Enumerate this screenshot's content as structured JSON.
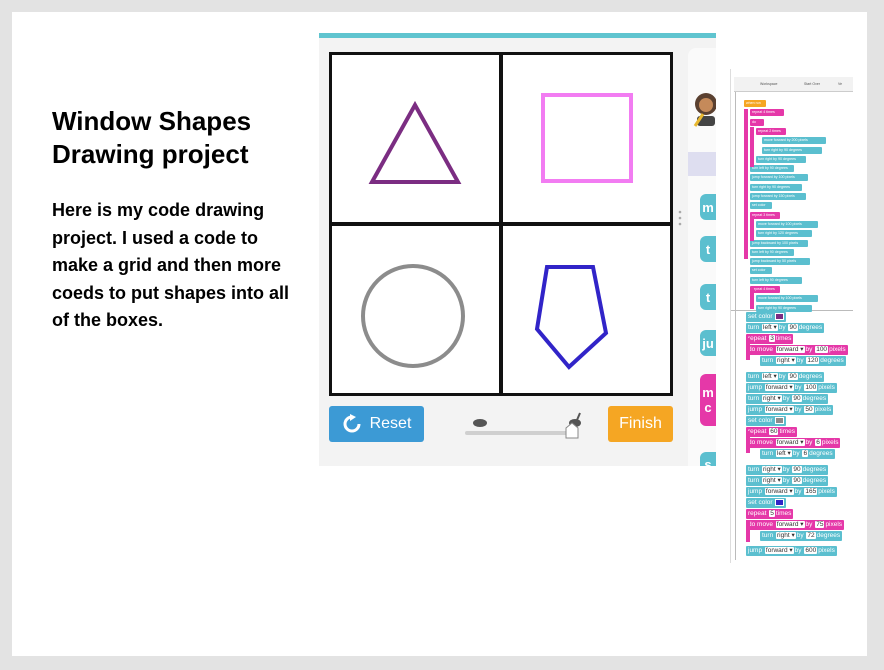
{
  "slide": {
    "title": "Window Shapes\nDrawing project",
    "body": "Here is my code drawing project. I used a code to make a grid and then more coeds to put shapes into all of the boxes."
  },
  "app": {
    "reset_label": "Reset",
    "finish_label": "Finish",
    "side_tabs": [
      "m",
      "t",
      "t",
      "ju",
      "m",
      "c",
      "s"
    ],
    "shape_colors": {
      "triangle": "#7b2d82",
      "square": "#f27cf2",
      "circle": "#8c8c8c",
      "pentagon": "#3124c8"
    },
    "accent_colors": {
      "reset": "#3c9ad5",
      "finish": "#f5a623",
      "topbar": "#5fc4cf",
      "block": "#5bbfcf",
      "loop": "#e538a8"
    }
  },
  "code_panel": {
    "toolbar": {
      "a": "Workspace",
      "b": "Start Over",
      "c": "Ve"
    },
    "upper_blocks": [
      {
        "text": "when run",
        "style": "orange"
      },
      {
        "text": "repeat 4 times",
        "style": "pink"
      },
      {
        "text": "do",
        "style": "pink"
      },
      {
        "text": "repeat 2 times",
        "style": "pink"
      },
      {
        "text": "move forward by 200 pixels",
        "style": "teal"
      },
      {
        "text": "turn right by 90 degrees",
        "style": "teal"
      },
      {
        "text": "turn right by 90 degrees",
        "style": "teal"
      },
      {
        "text": "turn left by 90 degrees",
        "style": "teal"
      },
      {
        "text": "jump forward by 100 pixels",
        "style": "teal"
      },
      {
        "text": "turn right by 90 degrees",
        "style": "teal"
      },
      {
        "text": "jump forward by 150 pixels",
        "style": "teal"
      },
      {
        "text": "set color",
        "style": "teal"
      },
      {
        "text": "repeat 3 times",
        "style": "pink"
      },
      {
        "text": "move forward by 100 pixels",
        "style": "teal"
      },
      {
        "text": "turn right by 120 degrees",
        "style": "teal"
      },
      {
        "text": "jump backward by 100 pixels",
        "style": "teal"
      },
      {
        "text": "turn left by 90 degrees",
        "style": "teal"
      },
      {
        "text": "jump backward by 50 pixels",
        "style": "teal"
      },
      {
        "text": "set color",
        "style": "teal"
      },
      {
        "text": "turn left by 90 degrees",
        "style": "teal"
      },
      {
        "text": "repeat 4 times",
        "style": "pink"
      },
      {
        "text": "move forward by 100 pixels",
        "style": "teal"
      },
      {
        "text": "turn right by 90 degrees",
        "style": "teal"
      }
    ],
    "lower_blocks": [
      {
        "parts": [
          "set color"
        ],
        "swatch": "#7b2d82"
      },
      {
        "parts": [
          "turn",
          "left ▾",
          "by",
          "90",
          "degrees"
        ]
      },
      {
        "parts": [
          "repeat",
          "3",
          "times"
        ],
        "style": "pink"
      },
      {
        "parts": [
          "do",
          "move",
          "forward ▾",
          "by",
          "100",
          "pixels"
        ],
        "style": "pink",
        "indent": 1
      },
      {
        "parts": [
          "turn",
          "right ▾",
          "by",
          "120",
          "degrees"
        ],
        "indent": 2
      },
      {
        "parts": [
          "turn",
          "left ▾",
          "by",
          "90",
          "degrees"
        ]
      },
      {
        "parts": [
          "jump",
          "forward ▾",
          "by",
          "100",
          "pixels"
        ]
      },
      {
        "parts": [
          "turn",
          "right ▾",
          "by",
          "90",
          "degrees"
        ]
      },
      {
        "parts": [
          "jump",
          "forward ▾",
          "by",
          "50",
          "pixels"
        ]
      },
      {
        "parts": [
          "set color"
        ],
        "swatch": "#8c8c8c"
      },
      {
        "parts": [
          "repeat",
          "60",
          "times"
        ],
        "style": "pink"
      },
      {
        "parts": [
          "do",
          "move",
          "forward ▾",
          "by",
          "6",
          "pixels"
        ],
        "style": "pink",
        "indent": 1
      },
      {
        "parts": [
          "turn",
          "left ▾",
          "by",
          "6",
          "degrees"
        ],
        "indent": 2
      },
      {
        "parts": [
          "turn",
          "right ▾",
          "by",
          "90",
          "degrees"
        ]
      },
      {
        "parts": [
          "turn",
          "right ▾",
          "by",
          "90",
          "degrees"
        ]
      },
      {
        "parts": [
          "jump",
          "forward ▾",
          "by",
          "165",
          "pixels"
        ]
      },
      {
        "parts": [
          "set color"
        ],
        "swatch": "#3124c8"
      },
      {
        "parts": [
          "repeat",
          "5",
          "times"
        ],
        "style": "pink"
      },
      {
        "parts": [
          "do",
          "move",
          "forward ▾",
          "by",
          "75",
          "pixels"
        ],
        "style": "pink",
        "indent": 1
      },
      {
        "parts": [
          "turn",
          "right ▾",
          "by",
          "72",
          "degrees"
        ],
        "indent": 2
      },
      {
        "parts": [
          "jump",
          "forward ▾",
          "by",
          "600",
          "pixels"
        ]
      }
    ]
  }
}
